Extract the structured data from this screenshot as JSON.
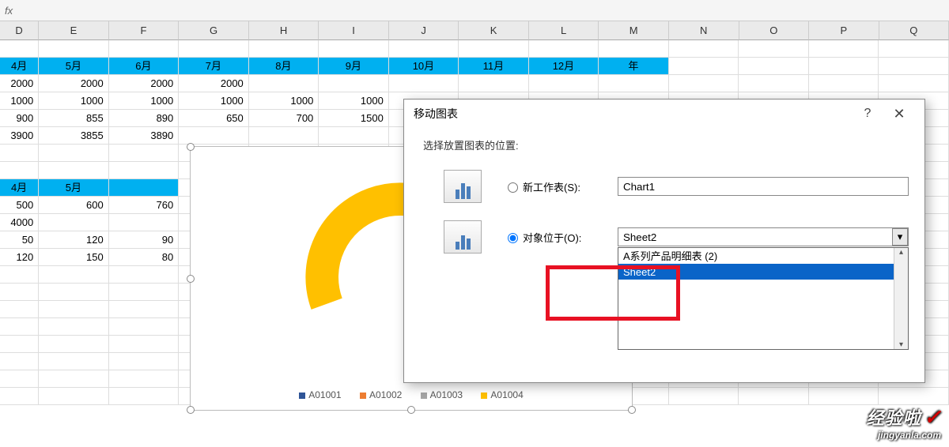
{
  "formula_bar": {
    "fx": "fx"
  },
  "cols": [
    "D",
    "E",
    "F",
    "G",
    "H",
    "I",
    "J",
    "K",
    "L",
    "M",
    "N",
    "O",
    "P",
    "Q"
  ],
  "headers1": [
    "4月",
    "5月",
    "6月",
    "7月",
    "8月",
    "9月",
    "10月",
    "11月",
    "12月",
    "年"
  ],
  "grid1": [
    [
      "2000",
      "2000",
      "2000",
      "2000",
      "",
      "",
      "",
      "",
      "",
      "",
      "",
      "",
      "",
      ""
    ],
    [
      "1000",
      "1000",
      "1000",
      "1000",
      "1000",
      "1000",
      "",
      "",
      "",
      "",
      "",
      "",
      "",
      ""
    ],
    [
      "900",
      "855",
      "890",
      "650",
      "700",
      "1500",
      "",
      "",
      "",
      "",
      "",
      "",
      "",
      ""
    ],
    [
      "3900",
      "3855",
      "3890",
      "",
      "",
      "",
      "",
      "",
      "",
      "",
      "",
      "",
      "",
      ""
    ]
  ],
  "headers2": [
    "4月",
    "5月"
  ],
  "grid2": [
    [
      "500",
      "600",
      "760"
    ],
    [
      "4000",
      "",
      ""
    ],
    [
      "50",
      "120",
      "90"
    ],
    [
      "120",
      "150",
      "80"
    ]
  ],
  "chart_data": {
    "type": "pie",
    "series_names": [
      "A01001",
      "A01002",
      "A01003",
      "A01004"
    ],
    "colors": [
      "#2f5597",
      "#ed7d31",
      "#a5a5a5",
      "#ffc000"
    ],
    "note": "donut chart, values not labeled; yellow segment large (~40-45%), gray+blue at bottom; legend only shows series names"
  },
  "dialog": {
    "title": "移动图表",
    "subtitle": "选择放置图表的位置:",
    "opt_new_label": "新工作表(S):",
    "opt_new_value": "Chart1",
    "opt_obj_label": "对象位于(O):",
    "opt_obj_value": "Sheet2",
    "dropdown_items": [
      "A系列产品明细表 (2)",
      "Sheet2"
    ],
    "dropdown_selected": "Sheet2",
    "help": "?",
    "close": "✕"
  },
  "watermark": {
    "big": "经验啦",
    "check": "✓",
    "small": "jingyanla.com"
  }
}
